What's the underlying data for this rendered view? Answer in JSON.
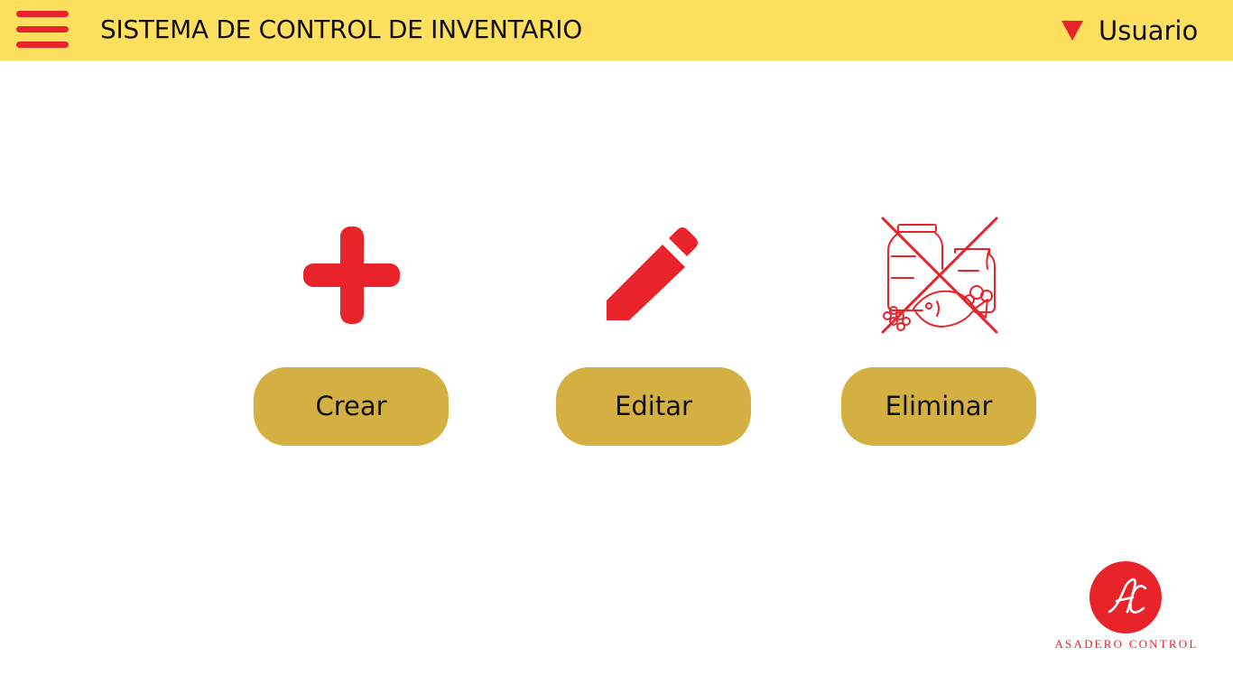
{
  "header": {
    "title": "SISTEMA DE CONTROL DE INVENTARIO",
    "menu_icon": "hamburger-icon",
    "user_menu_icon": "caret-down-icon",
    "user_label": "Usuario"
  },
  "actions": [
    {
      "label": "Crear",
      "icon": "plus-icon"
    },
    {
      "label": "Editar",
      "icon": "pencil-icon"
    },
    {
      "label": "Eliminar",
      "icon": "no-food-icon"
    }
  ],
  "logo": {
    "text": "ASADERO CONTROL",
    "monogram": "AC"
  },
  "colors": {
    "header_background": "#fedf5e",
    "accent_red": "#e8232a",
    "button_gold": "#d4af41",
    "text_dark": "#111111"
  }
}
